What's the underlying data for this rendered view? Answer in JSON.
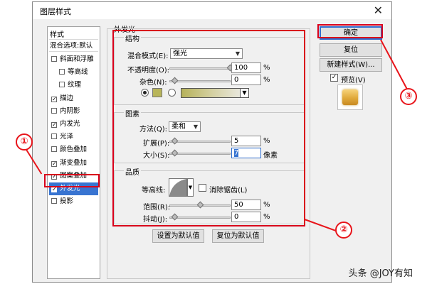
{
  "window": {
    "title": "图层样式",
    "close_glyph": "✕"
  },
  "styles_panel": {
    "header": "样式",
    "blend_options": "混合选项:默认",
    "items": [
      {
        "label": "斜面和浮雕",
        "checked": false
      },
      {
        "label": "等高线",
        "checked": false
      },
      {
        "label": "纹理",
        "checked": false
      },
      {
        "label": "描边",
        "checked": true
      },
      {
        "label": "内阴影",
        "checked": false
      },
      {
        "label": "内发光",
        "checked": true
      },
      {
        "label": "光泽",
        "checked": false
      },
      {
        "label": "颜色叠加",
        "checked": false
      },
      {
        "label": "渐变叠加",
        "checked": true
      },
      {
        "label": "图案叠加",
        "checked": true
      },
      {
        "label": "外发光",
        "checked": true,
        "selected": true
      },
      {
        "label": "投影",
        "checked": false
      }
    ]
  },
  "outer_glow": {
    "section_title": "外发光",
    "structure": {
      "title": "结构",
      "blend_mode_label": "混合模式(E):",
      "blend_mode_value": "强光",
      "opacity_label": "不透明度(O):",
      "opacity_value": "100",
      "opacity_unit": "%",
      "noise_label": "杂色(N):",
      "noise_value": "0",
      "noise_unit": "%",
      "swatch_color": "#b8b55a"
    },
    "elements": {
      "title": "图素",
      "method_label": "方法(Q):",
      "method_value": "柔和",
      "spread_label": "扩展(P):",
      "spread_value": "5",
      "spread_unit": "%",
      "size_label": "大小(S):",
      "size_value": "7",
      "size_unit": "像素"
    },
    "quality": {
      "title": "品质",
      "contour_label": "等高线:",
      "antialias_label": "消除锯齿(L)",
      "range_label": "范围(R):",
      "range_value": "50",
      "range_unit": "%",
      "jitter_label": "抖动(J):",
      "jitter_value": "0",
      "jitter_unit": "%"
    },
    "set_default_button": "设置为默认值",
    "reset_default_button": "复位为默认值"
  },
  "buttons": {
    "ok": "确定",
    "reset": "复位",
    "new_style": "新建样式(W)...",
    "preview_label": "预览(V)",
    "preview_checked": "✓"
  },
  "annotations": {
    "marker_1": "①",
    "marker_2": "②",
    "marker_3": "③",
    "color": "#d9001b"
  },
  "watermark": "头条 @JOY有知"
}
